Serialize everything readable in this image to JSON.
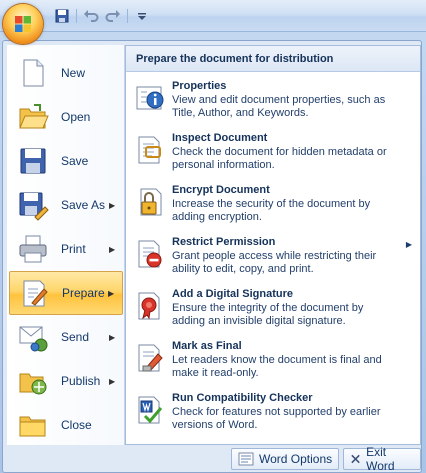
{
  "qat": {
    "icons": [
      "save-icon",
      "undo-icon",
      "redo-icon",
      "customize-icon"
    ]
  },
  "left_menu": [
    {
      "key": "new",
      "label": "New",
      "has_arrow": false,
      "active": false,
      "icon": "new-document-icon"
    },
    {
      "key": "open",
      "label": "Open",
      "has_arrow": false,
      "active": false,
      "icon": "open-folder-icon"
    },
    {
      "key": "save",
      "label": "Save",
      "has_arrow": false,
      "active": false,
      "icon": "save-disk-icon"
    },
    {
      "key": "save-as",
      "label": "Save As",
      "has_arrow": true,
      "active": false,
      "icon": "save-as-icon"
    },
    {
      "key": "print",
      "label": "Print",
      "has_arrow": true,
      "active": false,
      "icon": "printer-icon"
    },
    {
      "key": "prepare",
      "label": "Prepare",
      "has_arrow": true,
      "active": true,
      "icon": "prepare-icon"
    },
    {
      "key": "send",
      "label": "Send",
      "has_arrow": true,
      "active": false,
      "icon": "send-icon"
    },
    {
      "key": "publish",
      "label": "Publish",
      "has_arrow": true,
      "active": false,
      "icon": "publish-icon"
    },
    {
      "key": "close",
      "label": "Close",
      "has_arrow": false,
      "active": false,
      "icon": "close-folder-icon"
    }
  ],
  "submenu": {
    "header": "Prepare the document for distribution",
    "items": [
      {
        "key": "properties",
        "title": "Properties",
        "desc": "View and edit document properties, such as Title, Author, and Keywords.",
        "icon": "properties-icon",
        "has_arrow": false
      },
      {
        "key": "inspect",
        "title": "Inspect Document",
        "desc": "Check the document for hidden metadata or personal information.",
        "icon": "inspect-document-icon",
        "has_arrow": false
      },
      {
        "key": "encrypt",
        "title": "Encrypt Document",
        "desc": "Increase the security of the document by adding encryption.",
        "icon": "encrypt-keys-icon",
        "has_arrow": false
      },
      {
        "key": "restrict",
        "title": "Restrict Permission",
        "desc": "Grant people access while restricting their ability to edit, copy, and print.",
        "icon": "restrict-permission-icon",
        "has_arrow": true
      },
      {
        "key": "signature",
        "title": "Add a Digital Signature",
        "desc": "Ensure the integrity of the document by adding an invisible digital signature.",
        "icon": "digital-signature-icon",
        "has_arrow": false
      },
      {
        "key": "final",
        "title": "Mark as Final",
        "desc": "Let readers know the document is final and make it read-only.",
        "icon": "mark-final-icon",
        "has_arrow": false
      },
      {
        "key": "compat",
        "title": "Run Compatibility Checker",
        "desc": "Check for features not supported by earlier versions of Word.",
        "icon": "compatibility-checker-icon",
        "has_arrow": false
      }
    ]
  },
  "bottom": {
    "options_label": "Word Options",
    "exit_label": "Exit Word"
  },
  "colors": {
    "active_highlight": "#ffd66b",
    "frame": "#dfe9f5",
    "text": "#15325a"
  }
}
